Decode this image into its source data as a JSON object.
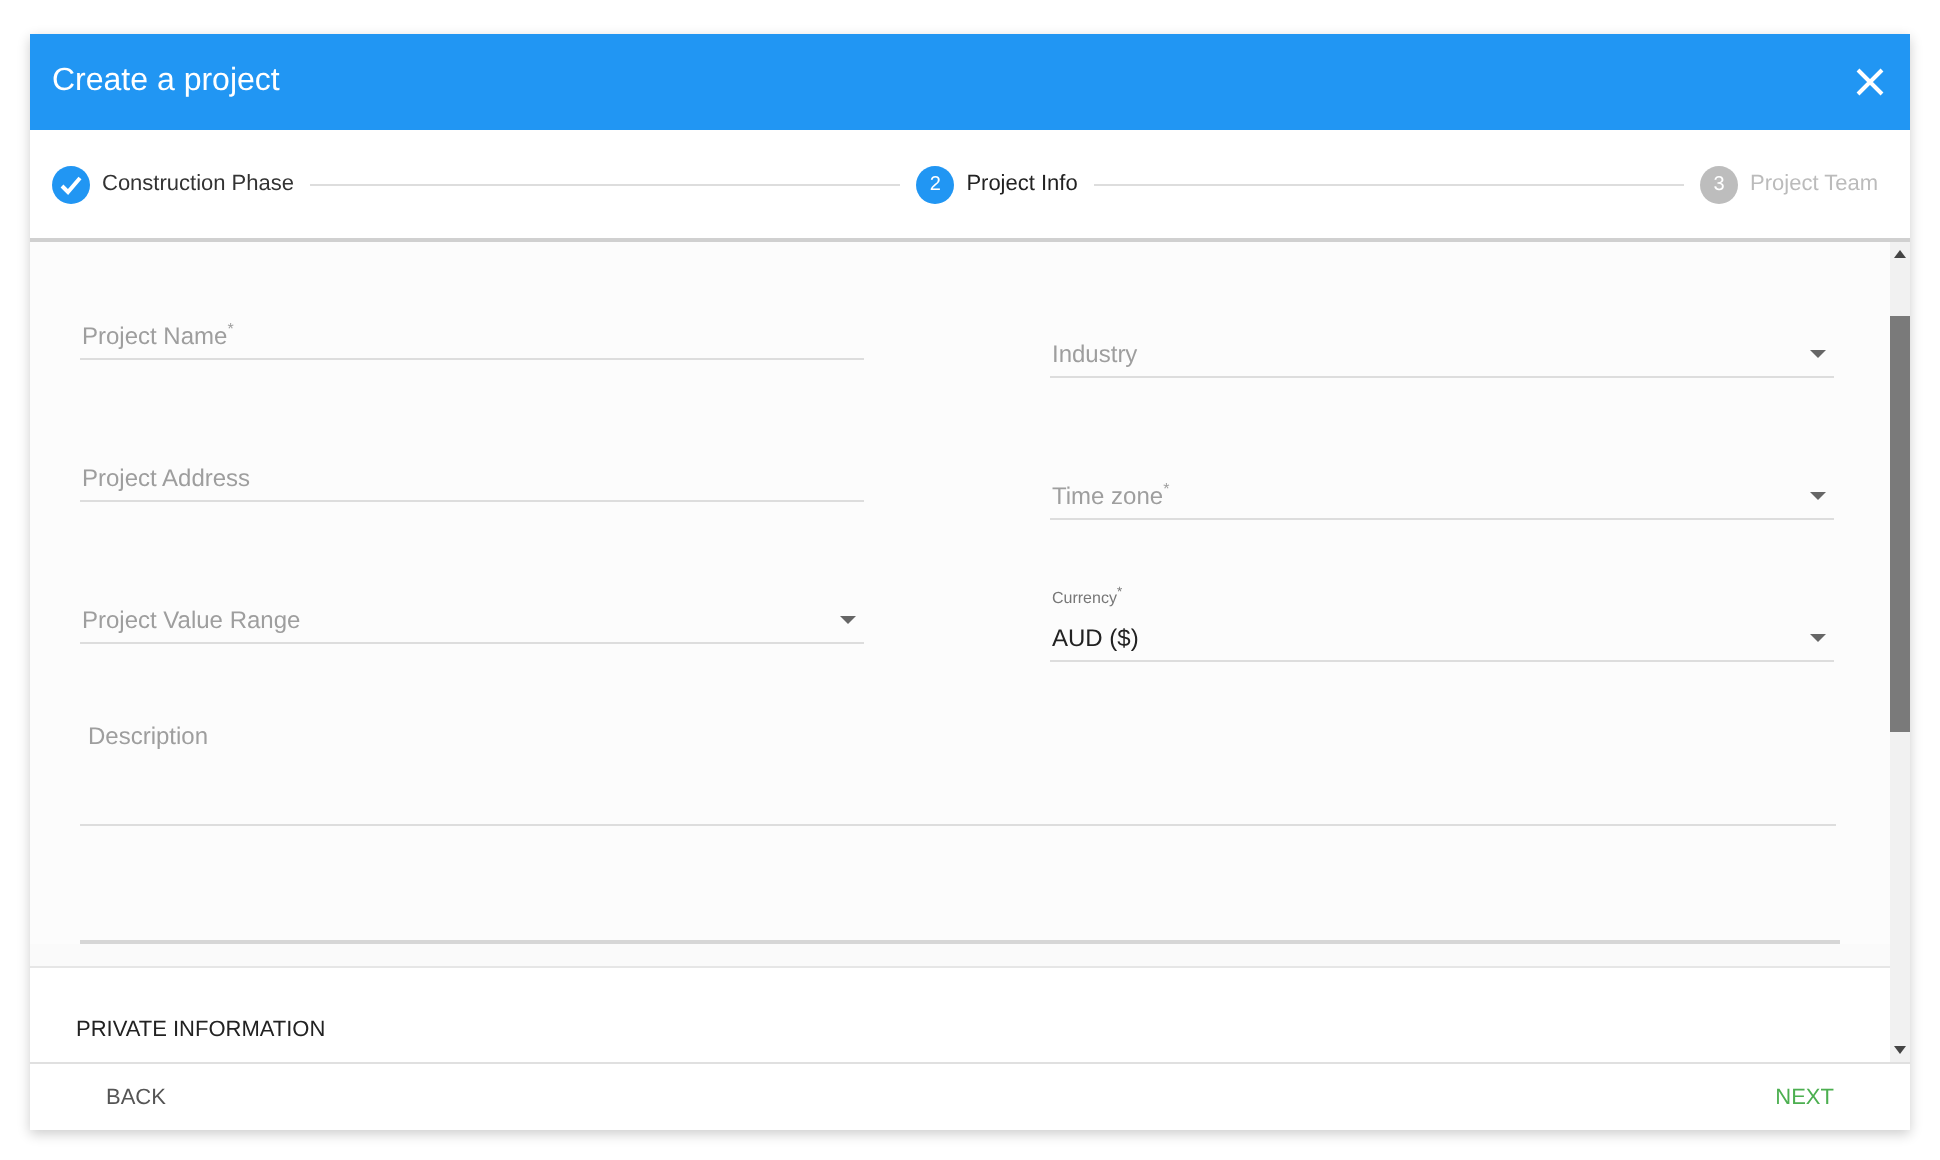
{
  "dialog": {
    "title": "Create a project"
  },
  "steps": [
    {
      "label": "Construction Phase",
      "completed": true,
      "selected": false
    },
    {
      "number": "2",
      "label": "Project Info",
      "completed": false,
      "selected": true
    },
    {
      "number": "3",
      "label": "Project Team",
      "completed": false,
      "selected": false
    }
  ],
  "fields_left": [
    {
      "kind": "text",
      "label": "Project Name$^{*}$"
    },
    {
      "kind": "text",
      "label": "Project Address"
    },
    {
      "kind": "select",
      "label": "Project Value Range"
    }
  ],
  "fields_right": [
    {
      "kind": "select",
      "label": "Industry"
    },
    {
      "kind": "select",
      "label": "Time zone$^{*}$"
    },
    {
      "kind": "select",
      "label": "Currency$^{*}$",
      "value": "AUD ($)"
    }
  ],
  "description": {
    "label": "Description"
  },
  "section": {
    "title": "PRIVATE INFORMATION"
  },
  "footer": {
    "back": "BACK",
    "next": "NEXT"
  }
}
